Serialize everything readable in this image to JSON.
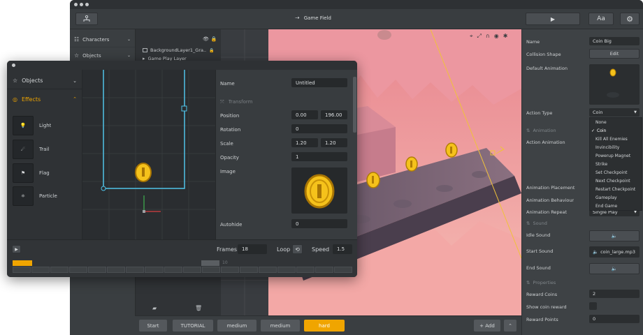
{
  "window": {
    "title": "Game Field"
  },
  "toolbar": {
    "play_icon": "play-icon",
    "font_label": "Aa",
    "settings_icon": "gear-icon",
    "scene_icon": "hierarchy-icon"
  },
  "sidebar": {
    "items": [
      {
        "label": "Characters"
      },
      {
        "label": "Objects"
      }
    ]
  },
  "layers": {
    "rows": [
      {
        "label": "BackgroundLayer1_Gra..."
      },
      {
        "label": "Game Play Layer"
      }
    ]
  },
  "canvas_tools": [
    "crosshair-icon",
    "expand-icon",
    "magnet-icon",
    "eye-icon",
    "bug-icon"
  ],
  "inspector": {
    "name_label": "Name",
    "name_value": "Coin Big",
    "collision_label": "Collision Shape",
    "collision_button": "Edit",
    "default_anim_label": "Default Animation",
    "action_type_label": "Action Type",
    "action_type_value": "Coin",
    "animation_section": "Animation",
    "action_anim_label": "Action Animation",
    "anim_placement_label": "Animation Placement",
    "anim_behaviour_label": "Animation Behaviour",
    "anim_repeat_label": "Animation Repeat",
    "anim_repeat_value": "Single Play",
    "sound_section": "Sound",
    "idle_sound_label": "Idle Sound",
    "start_sound_label": "Start Sound",
    "start_sound_value": "coin_large.mp3",
    "end_sound_label": "End Sound",
    "properties_section": "Properties",
    "reward_coins_label": "Reward Coins",
    "reward_coins_value": "2",
    "show_reward_label": "Show coin reward",
    "reward_points_label": "Reward Points",
    "reward_points_value": "0",
    "dropdown_options": [
      "None",
      "Coin",
      "Kill All Enemies",
      "Invincibility",
      "Powerup Magnet",
      "Strike",
      "Set Checkpoint",
      "Next Checkpoint",
      "Restart Checkpoint",
      "Gameplay",
      "End Game"
    ],
    "dropdown_selected": "Coin"
  },
  "bottombar": {
    "chips": [
      {
        "label": "Start"
      },
      {
        "label": "TUTORIAL"
      },
      {
        "label": "medium"
      },
      {
        "label": "medium"
      },
      {
        "label": "hard"
      }
    ],
    "add_label": "+ Add"
  },
  "editor": {
    "objects_label": "Objects",
    "effects_label": "Effects",
    "effects": [
      {
        "label": "Light"
      },
      {
        "label": "Trail"
      },
      {
        "label": "Flag"
      },
      {
        "label": "Particle"
      }
    ],
    "props": {
      "name_label": "Name",
      "name_value": "Untitled",
      "transform_section": "Transform",
      "position_label": "Position",
      "position_x": "0.00",
      "position_y": "196.00",
      "rotation_label": "Rotation",
      "rotation_value": "0",
      "scale_label": "Scale",
      "scale_x": "1.20",
      "scale_y": "1.20",
      "opacity_label": "Opacity",
      "opacity_value": "1",
      "image_label": "Image",
      "autohide_label": "Autohide",
      "autohide_value": "0"
    },
    "frames_label": "Frames",
    "frames_value": "18",
    "loop_label": "Loop",
    "speed_label": "Speed",
    "speed_value": "1.5",
    "timeline_marker": "10"
  },
  "colors": {
    "accent": "#f0a500",
    "selection": "#4fc3e8",
    "canvas_pink": "#f2aeaa"
  }
}
